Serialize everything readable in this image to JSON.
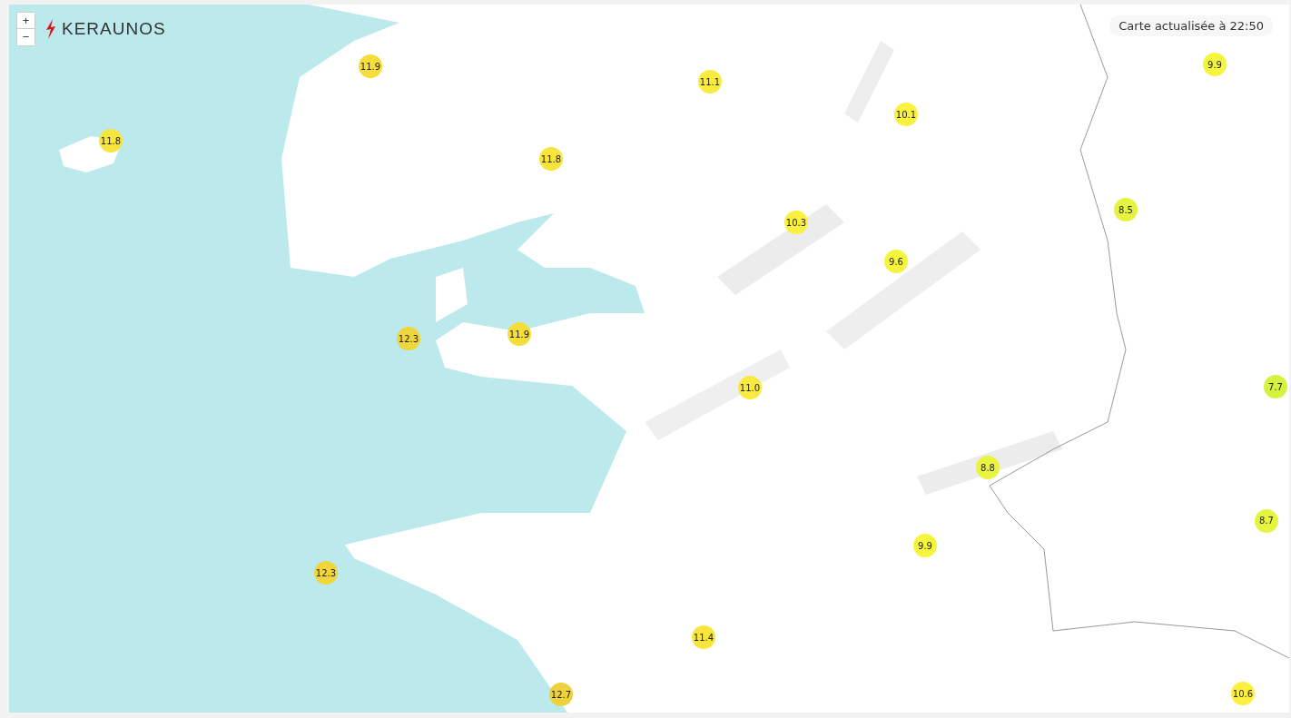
{
  "zoom_controls": [
    {
      "label": "+"
    },
    {
      "label": "−"
    }
  ],
  "logo": {
    "text": "KERAUNOS"
  },
  "update_label": "Carte actualisée à 22:50",
  "markers": [
    {
      "value": "11.9",
      "color": "#f5de3a"
    },
    {
      "value": "11.1",
      "color": "#faec3e"
    },
    {
      "value": "11.8",
      "color": "#f7e43c"
    },
    {
      "value": "11.8",
      "color": "#f7e43c"
    },
    {
      "value": "10.1",
      "color": "#fbf23f"
    },
    {
      "value": "9.9",
      "color": "#f4f53c"
    },
    {
      "value": "10.3",
      "color": "#fbf03f"
    },
    {
      "value": "8.5",
      "color": "#e7f43f"
    },
    {
      "value": "9.6",
      "color": "#f6f53e"
    },
    {
      "value": "12.3",
      "color": "#f0d63b"
    },
    {
      "value": "11.9",
      "color": "#f5de3a"
    },
    {
      "value": "11.0",
      "color": "#f9ea3d"
    },
    {
      "value": "7.7",
      "color": "#d6f240"
    },
    {
      "value": "8.8",
      "color": "#e8f43f"
    },
    {
      "value": "8.7",
      "color": "#e6f43f"
    },
    {
      "value": "9.9",
      "color": "#f4f53c"
    },
    {
      "value": "12.3",
      "color": "#f0d63b"
    },
    {
      "value": "11.4",
      "color": "#f8e63c"
    },
    {
      "value": "12.7",
      "color": "#eed13b"
    },
    {
      "value": "10.6",
      "color": "#fbf03f"
    }
  ]
}
